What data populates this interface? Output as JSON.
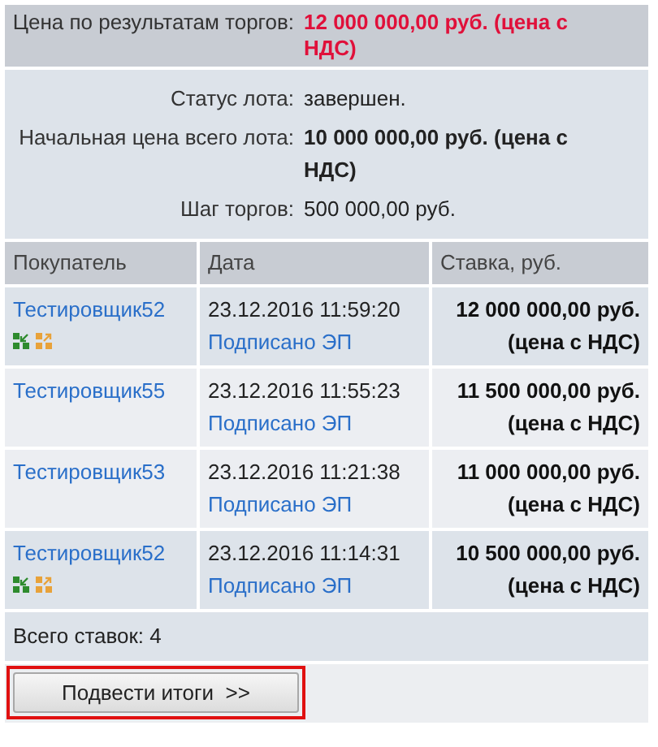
{
  "result_price": {
    "label": "Цена по результатам торгов:",
    "value": "12 000 000,00 руб. (цена с НДС)"
  },
  "lot_info": [
    {
      "label": "Статус лота:",
      "value": "завершен.",
      "bold": false
    },
    {
      "label": "Начальная цена всего лота:",
      "value": "10 000 000,00 руб. (цена с НДС)",
      "bold": true
    },
    {
      "label": "Шаг торгов:",
      "value": "500 000,00 руб.",
      "bold": false
    }
  ],
  "table": {
    "columns": [
      "Покупатель",
      "Дата",
      "Ставка, руб."
    ],
    "rows": [
      {
        "buyer": "Тестировщик52",
        "doc_icons": true,
        "date": "23.12.2016 11:59:20",
        "signed": "Подписано ЭП",
        "bid": "12 000 000,00 руб. (цена с НДС)",
        "shaded": true
      },
      {
        "buyer": "Тестировщик55",
        "doc_icons": false,
        "date": "23.12.2016 11:55:23",
        "signed": "Подписано ЭП",
        "bid": "11 500 000,00 руб. (цена с НДС)",
        "shaded": false
      },
      {
        "buyer": "Тестировщик53",
        "doc_icons": false,
        "date": "23.12.2016 11:21:38",
        "signed": "Подписано ЭП",
        "bid": "11 000 000,00 руб. (цена с НДС)",
        "shaded": false
      },
      {
        "buyer": "Тестировщик52",
        "doc_icons": true,
        "date": "23.12.2016 11:14:31",
        "signed": "Подписано ЭП",
        "bid": "10 500 000,00 руб. (цена с НДС)",
        "shaded": true
      }
    ]
  },
  "total": "Всего ставок: 4",
  "button": {
    "label": "Подвести итоги  >>",
    "highlighted": true
  }
}
